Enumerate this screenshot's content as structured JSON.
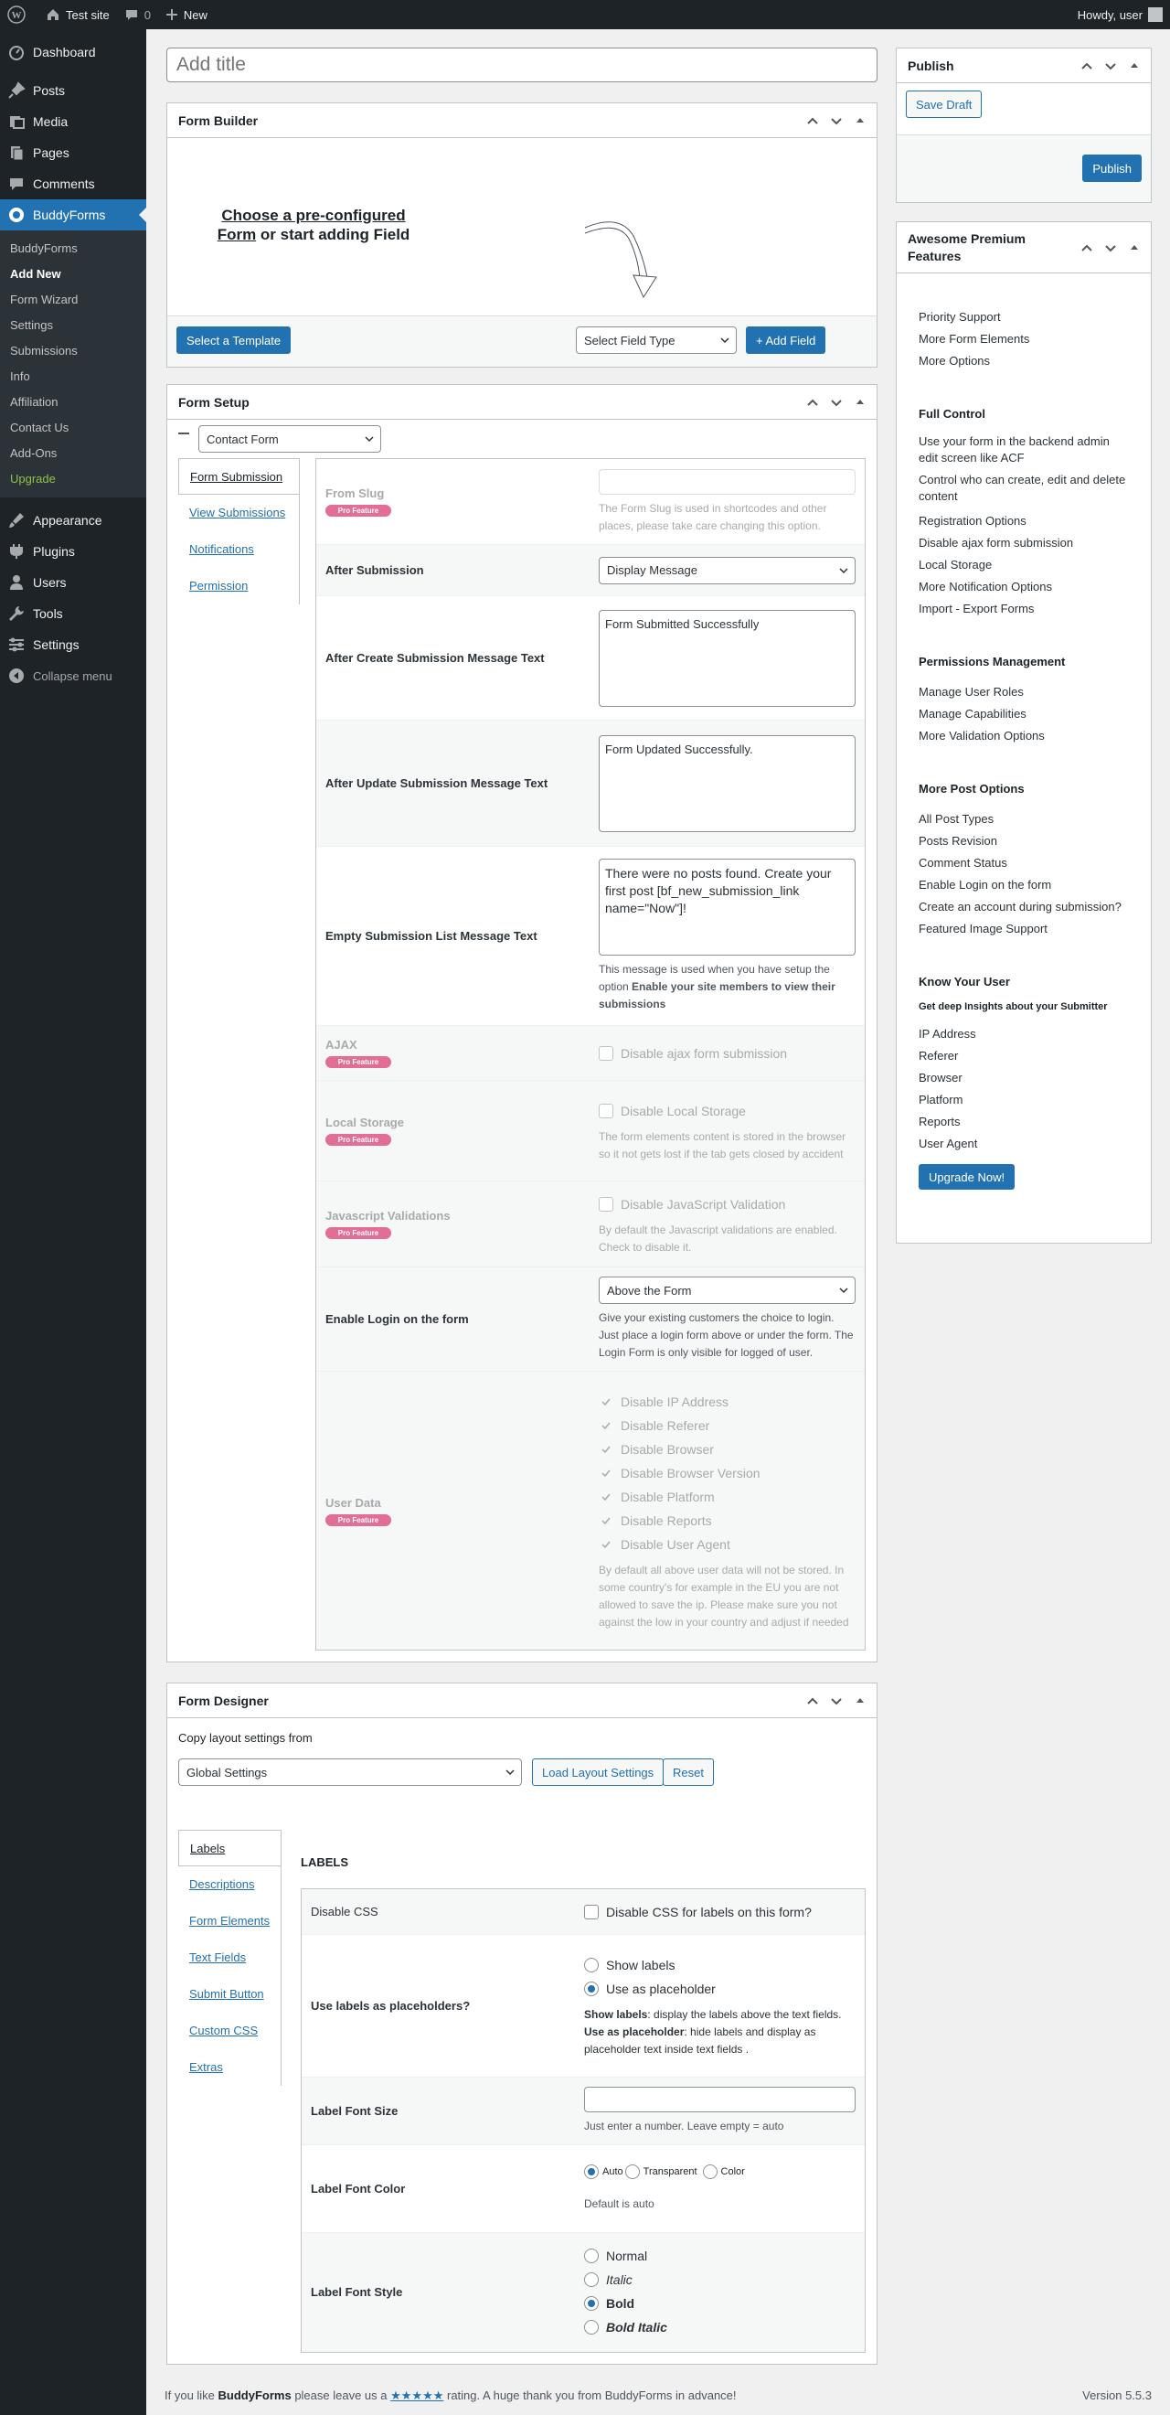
{
  "adminbar": {
    "site": "Test site",
    "comments": "0",
    "new": "New",
    "howdy": "Howdy, user"
  },
  "menu": {
    "dashboard": "Dashboard",
    "posts": "Posts",
    "media": "Media",
    "pages": "Pages",
    "comments": "Comments",
    "buddyforms": "BuddyForms",
    "sub": [
      "BuddyForms",
      "Add New",
      "Form Wizard",
      "Settings",
      "Submissions",
      "Info",
      "Affiliation",
      "Contact Us",
      "Add-Ons",
      "Upgrade"
    ],
    "appearance": "Appearance",
    "plugins": "Plugins",
    "users": "Users",
    "tools": "Tools",
    "settings": "Settings",
    "collapse": "Collapse menu"
  },
  "title_placeholder": "Add title",
  "form_builder": {
    "title": "Form Builder",
    "choose_bold": "Choose a pre-configured Form",
    "choose_rest": " or start adding Field",
    "select_template": "Select a Template",
    "field_type": "Select Field Type",
    "add_field": "+ Add Field"
  },
  "form_setup": {
    "title": "Form Setup",
    "form_type": "Contact Form",
    "tabs": [
      "Form Submission",
      "View Submissions",
      "Notifications",
      "Permission"
    ],
    "pro_badge": "Pro Feature",
    "form_slug": {
      "label": "From Slug",
      "desc": "The Form Slug is used in shortcodes and other places, please take care changing this option."
    },
    "after_submission": {
      "label": "After Submission",
      "value": "Display Message"
    },
    "after_create": {
      "label": "After Create Submission Message Text",
      "value": "Form Submitted Successfully"
    },
    "after_update": {
      "label": "After Update Submission Message Text",
      "value": "Form Updated Successfully."
    },
    "empty_list": {
      "label": "Empty Submission List Message Text",
      "value": "There were no posts found. Create your first post [bf_new_submission_link name=\"Now\"]!",
      "desc1": "This message is used when you have setup the option ",
      "desc_bold": "Enable your site members to view their submissions"
    },
    "ajax": {
      "label": "AJAX",
      "option": "Disable ajax form submission"
    },
    "local_storage": {
      "label": "Local Storage",
      "option": "Disable Local Storage",
      "desc": "The form elements content is stored in the browser so it not gets lost if the tab gets closed by accident"
    },
    "js_validation": {
      "label": "Javascript Validations",
      "option": "Disable JavaScript Validation",
      "desc": "By default the Javascript validations are enabled. Check to disable it."
    },
    "login": {
      "label": "Enable Login on the form",
      "value": "Above the Form",
      "desc": "Give your existing customers the choice to login. Just place a login form above or under the form. The Login Form is only visible for logged of user."
    },
    "user_data": {
      "label": "User Data",
      "options": [
        "Disable IP Address",
        "Disable Referer",
        "Disable Browser",
        "Disable Browser Version",
        "Disable Platform",
        "Disable Reports",
        "Disable User Agent"
      ],
      "desc": "By default all above user data will not be stored. In some country's for example in the EU you are not allowed to save the ip. Please make sure you not against the low in your country and adjust if needed"
    }
  },
  "form_designer": {
    "title": "Form Designer",
    "copy_label": "Copy layout settings from",
    "copy_value": "Global Settings",
    "load_btn": "Load Layout Settings",
    "reset_btn": "Reset",
    "tabs": [
      "Labels",
      "Descriptions",
      "Form Elements",
      "Text Fields",
      "Submit Button",
      "Custom CSS",
      "Extras"
    ],
    "section": "LABELS",
    "disable_css": {
      "label": "Disable CSS",
      "option": "Disable CSS for labels on this form?"
    },
    "placeholders": {
      "label": "Use labels as placeholders?",
      "opt1": "Show labels",
      "opt2": "Use as placeholder",
      "d1b": "Show labels",
      "d1": ": display the labels above the text fields.",
      "d2b": "Use as placeholder",
      "d2": ": hide labels and display as placeholder text inside text fields ."
    },
    "font_size": {
      "label": "Label Font Size",
      "desc": "Just enter a number. Leave empty = auto"
    },
    "font_color": {
      "label": "Label Font Color",
      "opts": [
        "Auto",
        "Transparent",
        "Color"
      ],
      "desc": "Default is auto"
    },
    "font_style": {
      "label": "Label Font Style",
      "opts": [
        "Normal",
        "Italic",
        "Bold",
        "Bold Italic"
      ]
    }
  },
  "publish": {
    "title": "Publish",
    "save_draft": "Save Draft",
    "publish": "Publish"
  },
  "premium": {
    "title": "Awesome Premium Features",
    "list1": [
      "Priority Support",
      "More Form Elements",
      "More Options"
    ],
    "full_control": "Full Control",
    "list2": [
      "Use your form in the backend admin edit screen like ACF",
      "Control who can create, edit and delete content",
      "Registration Options",
      "Disable ajax form submission",
      "Local Storage",
      "More Notification Options",
      "Import - Export Forms"
    ],
    "permissions": "Permissions Management",
    "list3": [
      "Manage User Roles",
      "Manage Capabilities",
      "More Validation Options"
    ],
    "post_options": "More Post Options",
    "list4": [
      "All Post Types",
      "Posts Revision",
      "Comment Status",
      "Enable Login on the form",
      "Create an account during submission?",
      "Featured Image Support"
    ],
    "know_user": "Know Your User",
    "insights": "Get deep Insights about your Submitter",
    "list5": [
      "IP Address",
      "Referer",
      "Browser",
      "Platform",
      "Reports",
      "User Agent"
    ],
    "upgrade": "Upgrade Now!"
  },
  "footer": {
    "pre": "If you like ",
    "brand": "BuddyForms",
    "mid": " please leave us a ",
    "stars": "★★★★★",
    "post": " rating. A huge thank you from BuddyForms in advance!",
    "version": "Version 5.5.3"
  }
}
